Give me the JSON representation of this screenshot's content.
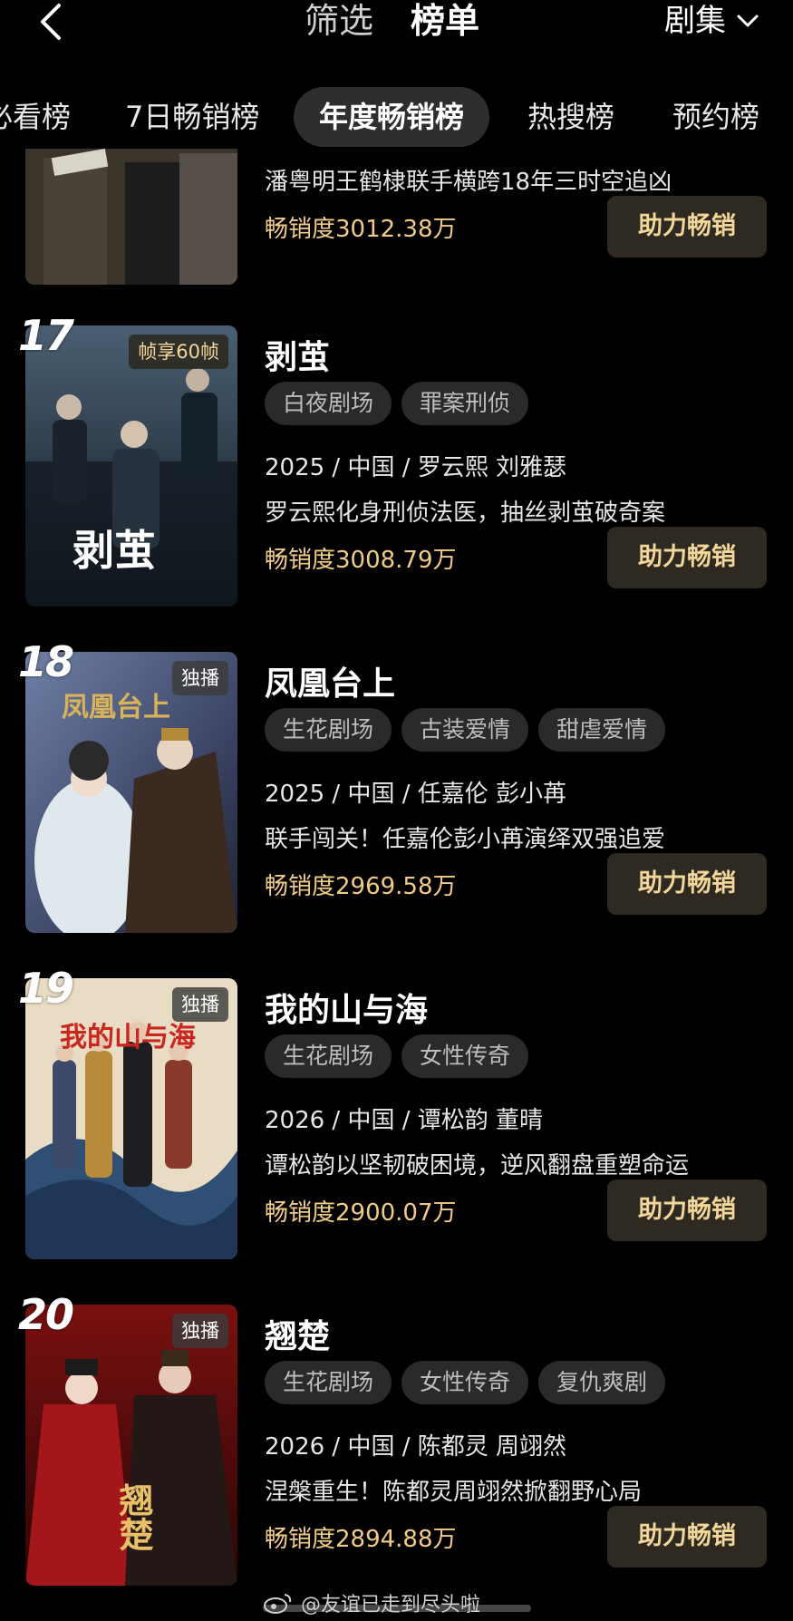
{
  "header": {
    "filter_label": "筛选",
    "rank_label": "榜单",
    "category_label": "剧集"
  },
  "subtabs": [
    "必看榜",
    "7日畅销榜",
    "年度畅销榜",
    "热搜榜",
    "预约榜"
  ],
  "active_subtab": "年度畅销榜",
  "items": [
    {
      "rank": "",
      "title": "",
      "tags": [],
      "meta": "",
      "desc": "潘粤明王鹤棣联手横跨18年三时空追凶",
      "sales": "畅销度3012.38万",
      "button": "助力畅销",
      "badge": ""
    },
    {
      "rank": "17",
      "title": "剥茧",
      "tags": [
        "白夜剧场",
        "罪案刑侦"
      ],
      "meta": "2025 / 中国 / 罗云熙 刘雅瑟",
      "desc": "罗云熙化身刑侦法医，抽丝剥茧破奇案",
      "sales": "畅销度3008.79万",
      "button": "助力畅销",
      "badge": "帧享60帧",
      "poster_text": "剥茧"
    },
    {
      "rank": "18",
      "title": "凤凰台上",
      "tags": [
        "生花剧场",
        "古装爱情",
        "甜虐爱情"
      ],
      "meta": "2025 / 中国 / 任嘉伦 彭小苒",
      "desc": "联手闯关！任嘉伦彭小苒演绎双强追爱",
      "sales": "畅销度2969.58万",
      "button": "助力畅销",
      "badge": "独播",
      "poster_text": "凤凰台上"
    },
    {
      "rank": "19",
      "title": "我的山与海",
      "tags": [
        "生花剧场",
        "女性传奇"
      ],
      "meta": "2026 / 中国 / 谭松韵 董晴",
      "desc": "谭松韵以坚韧破困境，逆风翻盘重塑命运",
      "sales": "畅销度2900.07万",
      "button": "助力畅销",
      "badge": "独播",
      "poster_text": "我的山与海"
    },
    {
      "rank": "20",
      "title": "翘楚",
      "tags": [
        "生花剧场",
        "女性传奇",
        "复仇爽剧"
      ],
      "meta": "2026 / 中国 / 陈都灵 周翊然",
      "desc": "涅槃重生！陈都灵周翊然掀翻野心局",
      "sales": "畅销度2894.88万",
      "button": "助力畅销",
      "badge": "独播",
      "poster_text": "翘楚"
    }
  ],
  "watermark": "@友谊已走到尽头啦",
  "colors": {
    "background": "#000000",
    "accent_gold": "#f0cc88",
    "button_bg": "#2f2a21",
    "tag_bg": "#2a2a2c"
  }
}
